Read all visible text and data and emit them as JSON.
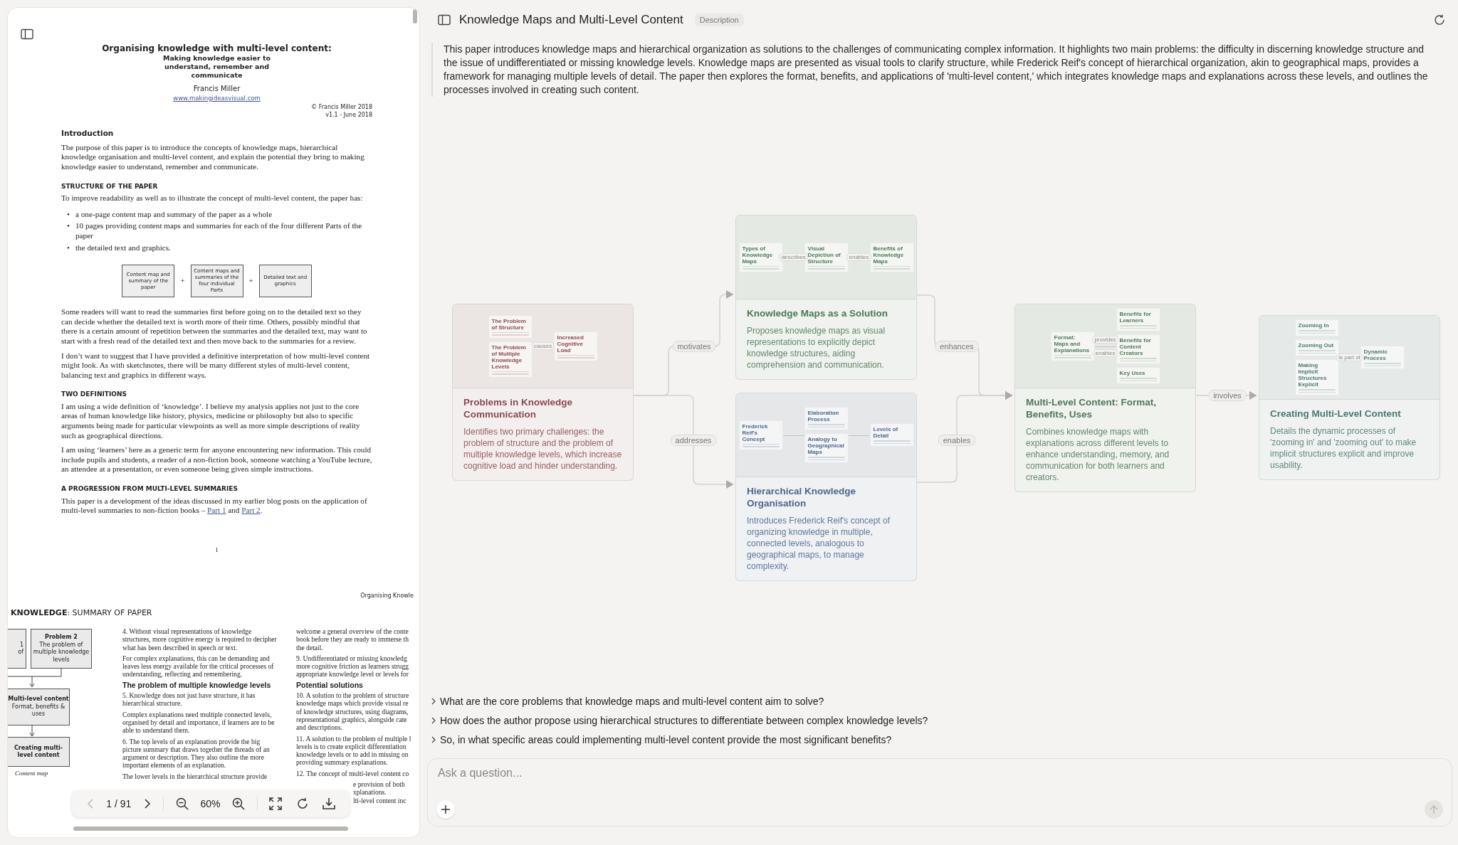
{
  "pdf": {
    "page1": {
      "title": "Organising knowledge with multi-level content:",
      "subtitle": "Making knowledge easier to understand, remember and communicate",
      "author": "Francis Miller",
      "website": "www.makingideasvisual.com",
      "copyright": "© Francis Miller 2018",
      "version": "v1.1 - June 2018",
      "blocks": [
        {
          "kind": "heading",
          "text": "Introduction"
        },
        {
          "kind": "paragraph",
          "text": "The purpose of this paper is to introduce the concepts of knowledge maps, hierarchical knowledge organisation and multi-level content, and explain the potential they bring to making knowledge easier to understand, remember and communicate."
        },
        {
          "kind": "subheading",
          "text": "STRUCTURE OF THE PAPER"
        },
        {
          "kind": "paragraph",
          "text": "To improve readability as well as to illustrate the concept of multi-level content, the paper has:"
        },
        {
          "kind": "bullets",
          "marker": "•",
          "items": [
            "a one-page content map and summary of the paper as a whole",
            "10 pages providing content maps and summaries for each of the four different Parts of the paper",
            "the detailed text and graphics."
          ]
        },
        {
          "kind": "diagram",
          "items": [
            {
              "kind": "box",
              "text": "Content map and summary of the paper"
            },
            {
              "kind": "plus",
              "text": "+"
            },
            {
              "kind": "box",
              "text": "Content maps and summaries of the four individual Parts"
            },
            {
              "kind": "plus",
              "text": "+"
            },
            {
              "kind": "box",
              "text": "Detailed text and graphics"
            }
          ]
        },
        {
          "kind": "paragraph",
          "text": "Some readers will want to read the summaries first before going on to the detailed text so they can decide whether the detailed text is worth more of their time. Others, possibly mindful that there is a certain amount of repetition between the summaries and the detailed text, may want to start with a fresh read of the detailed text and then move back to the summaries for a review."
        },
        {
          "kind": "paragraph",
          "text": "I don’t want to suggest that I have provided a definitive interpretation of how multi-level content might look. As with sketchnotes, there will be many different styles of multi-level content, balancing text and graphics in different ways."
        },
        {
          "kind": "subheading",
          "text": "TWO DEFINITIONS"
        },
        {
          "kind": "paragraph",
          "text": "I am using a wide definition of ‘knowledge’. I believe my analysis applies not just to the core areas of human knowledge like history, physics, medicine or philosophy but also to specific arguments being made for particular viewpoints as well as more simple descriptions of reality such as geographical directions."
        },
        {
          "kind": "paragraph",
          "text": "I am using ‘learners’ here as a generic term for anyone encountering new information. This could include pupils and students, a reader of a non-fiction book, someone watching a YouTube lecture, an attendee at a presentation, or even someone being given simple instructions."
        },
        {
          "kind": "subheading",
          "text": "A PROGRESSION FROM MULTI-LEVEL SUMMARIES"
        },
        {
          "kind": "linked",
          "parts": [
            {
              "text": "This paper is a development of the ideas discussed in my earlier blog posts on the application of multi-level summaries to non-fiction books – "
            },
            {
              "text": "Part 1",
              "link": true
            },
            {
              "text": " and "
            },
            {
              "text": "Part 2",
              "link": true
            },
            {
              "text": "."
            }
          ]
        }
      ],
      "page_number": "1"
    },
    "page2": {
      "running_header": "Organising Knowle",
      "heading": "**KNOWLEDGE**: SUMMARY OF PAPER",
      "map": {
        "cut_box": [
          "1",
          "of"
        ],
        "problem_box": {
          "title": "Problem 2",
          "text": "The problem of multiple knowledge levels"
        },
        "format_box": {
          "title": "Multi-level content",
          "text": "Format, benefits & uses"
        },
        "creating_box": {
          "title": "Creating multi-level content"
        },
        "caption": "Content map"
      },
      "middle": [
        {
          "kind": "paragraph",
          "text": "4. Without visual representations of knowledge structures, more cognitive energy is required to decipher what has been described in speech or text."
        },
        {
          "kind": "paragraph",
          "text": "For complex explanations, this can be demanding and leaves less energy available for the critical processes of understanding, reflecting and remembering."
        },
        {
          "kind": "heading",
          "text": "The problem of multiple knowledge levels"
        },
        {
          "kind": "paragraph",
          "text": "5. Knowledge does not just have structure, it has hierarchical structure."
        },
        {
          "kind": "paragraph",
          "text": "Complex explanations need multiple connected levels, organised by detail and importance, if learners are to be able to understand them."
        },
        {
          "kind": "paragraph",
          "text": "6. The top levels of an explanation provide the big picture summary that draws together the threads of an argument or description. They also outline the more important elements of an explanation."
        },
        {
          "kind": "paragraph",
          "text": "The lower levels in the hierarchical structure provide"
        }
      ],
      "right": [
        {
          "kind": "lines",
          "lines": [
            "welcome a general overview of the conte",
            "book before they are ready to immerse th",
            "the detail."
          ]
        },
        {
          "kind": "lines",
          "lines": [
            "9. Undifferentiated or missing knowledg",
            "more cognitive friction as learners strugg",
            "appropriate knowledge level or levels for"
          ]
        },
        {
          "kind": "heading",
          "text": "Potential solutions"
        },
        {
          "kind": "lines",
          "lines": [
            "10. A solution to the problem of structure",
            "knowledge maps which provide visual re",
            "of knowledge structures, using diagrams,",
            "representational graphics, alongside cate",
            "and descriptions."
          ]
        },
        {
          "kind": "lines",
          "lines": [
            "11. A solution to the problem of multiple l",
            "levels is to create explicit differentiation",
            "knowledge levels or to add in missing on",
            "providing summary explanations."
          ]
        },
        {
          "kind": "lines",
          "lines": [
            "12. The concept of multi-level content co"
          ]
        },
        {
          "kind": "fragment",
          "lines": [
            "e provision of both",
            "xplanations.",
            "lti-level content inc"
          ]
        }
      ]
    },
    "toolbar": {
      "prev_disabled": true,
      "next_disabled": false,
      "page": "1 / 91",
      "zoom": "60%"
    }
  },
  "header": {
    "title": "Knowledge Maps and Multi-Level Content",
    "badge": "Description"
  },
  "description": "This paper introduces knowledge maps and hierarchical organization as solutions to the challenges of communicating complex information. It highlights two main problems: the difficulty in discerning knowledge structure and the issue of undifferentiated or missing knowledge levels. Knowledge maps are presented as visual tools to clarify structure, while Frederick Reif's concept of hierarchical organization, akin to geographical maps, provides a framework for managing multiple levels of detail. The paper then explores the format, benefits, and applications of 'multi-level content,' which integrates knowledge maps and explanations across these levels, and outlines the processes involved in creating such content.",
  "graph": {
    "nodes": [
      {
        "title": "Problems in Knowledge Communication",
        "text": "Identifies two primary challenges: the problem of structure and the problem of multiple knowledge levels, which increase cognitive load and hinder understanding.",
        "color": "#8c4a4e",
        "preview": {
          "columns": [
            [
              "The Problem of Structure",
              "The Problem of Multiple Knowledge Levels"
            ],
            [
              "Increased Cognitive Load"
            ]
          ],
          "links": [
            [
              "causes"
            ]
          ]
        }
      },
      {
        "title": "Knowledge Maps as a Solution",
        "text": "Proposes knowledge maps as visual representations to explicitly depict knowledge structures, aiding comprehension and communication.",
        "color": "#4a7a55",
        "preview": {
          "columns": [
            [
              "Types of Knowledge Maps"
            ],
            [
              "Visual Depiction of Structure"
            ],
            [
              "Benefits of Knowledge Maps"
            ]
          ],
          "links": [
            [
              "describes"
            ],
            [
              "enables"
            ]
          ]
        }
      },
      {
        "title": "Hierarchical Knowledge Organisation",
        "text": "Introduces Frederick Reif's concept of organizing knowledge in multiple, connected levels, analogous to geographical maps, to manage complexity.",
        "color": "#4a6890",
        "preview": {
          "columns": [
            [
              "Frederick Reif's Concept"
            ],
            [
              "Elaboration Process",
              "Analogy to Geographical Maps"
            ],
            [
              "Levels of Detail"
            ]
          ]
        }
      },
      {
        "title": "Multi-Level Content: Format, Benefits, Uses",
        "text": "Combines knowledge maps with explanations across different levels to enhance understanding, memory, and communication for both learners and creators.",
        "color": "#4d7a58",
        "preview": {
          "columns": [
            [
              "Format: Maps and Explanations"
            ],
            [
              "Benefits for Learners",
              "Benefits for Content Creators",
              "Key Uses"
            ]
          ],
          "links": [
            [
              "provides",
              "enables"
            ]
          ]
        }
      },
      {
        "title": "Creating Multi-Level Content",
        "text": "Details the dynamic processes of 'zooming in' and 'zooming out' to make implicit structures explicit and improve usability.",
        "color": "#4a7a74",
        "preview": {
          "columns": [
            [
              "Zooming In",
              "Zooming Out",
              "Making Implicit Structures Explicit"
            ],
            [
              "Dynamic Process"
            ]
          ],
          "links": [
            [
              "is part of"
            ]
          ]
        }
      }
    ],
    "edges": [
      {
        "label": "motivates"
      },
      {
        "label": "addresses"
      },
      {
        "label": "enhances"
      },
      {
        "label": "enables"
      },
      {
        "label": "involves"
      }
    ]
  },
  "questions": [
    "What are the core problems that knowledge maps and multi-level content aim to solve?",
    "How does the author propose using hierarchical structures to differentiate between complex knowledge levels?",
    "So, in what specific areas could implementing multi-level content provide the most significant benefits?"
  ],
  "ask": {
    "placeholder": "Ask a question...",
    "send_disabled": true
  }
}
